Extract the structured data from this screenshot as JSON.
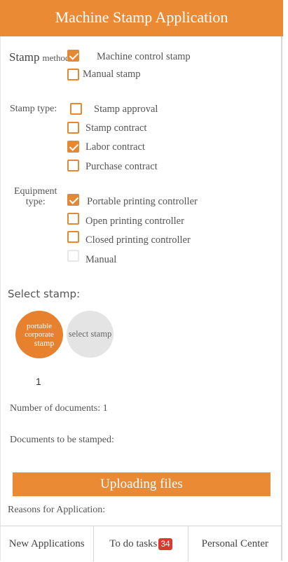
{
  "header": {
    "title": "Machine Stamp Application"
  },
  "stamp_method": {
    "label_a": "Stamp",
    "label_b": "method",
    "options": [
      {
        "label": "Machine control stamp",
        "checked": true
      },
      {
        "label": "Manual stamp",
        "checked": false
      }
    ]
  },
  "stamp_type": {
    "label": "Stamp type:",
    "options": [
      {
        "label": "Stamp approval",
        "checked": false
      },
      {
        "label": "Stamp contract",
        "checked": false
      },
      {
        "label": "Labor contract",
        "checked": true
      },
      {
        "label": "Purchase contract",
        "checked": false
      }
    ]
  },
  "equipment_type": {
    "label_a": "Equipment",
    "label_b": "type:",
    "options": [
      {
        "label": "Portable printing controller",
        "checked": true
      },
      {
        "label": "Open printing  controller",
        "checked": false
      },
      {
        "label": "Closed printing controller",
        "checked": false
      },
      {
        "label": "Manual",
        "checked": false
      }
    ]
  },
  "select_stamp": {
    "label": "Select stamp:",
    "selected_lines": [
      "portable",
      "corporate",
      "stamp"
    ],
    "unselected": "select stamp",
    "count": "1"
  },
  "documents": {
    "number_label": "Number of documents: 1",
    "to_be_stamped": "Documents to be stamped:"
  },
  "upload_label": "Uploading files",
  "reasons_label": "Reasons for Application:",
  "tabs": [
    {
      "label": "New Applications"
    },
    {
      "label": "To do tasks",
      "badge": "34"
    },
    {
      "label": "Personal Center"
    }
  ]
}
